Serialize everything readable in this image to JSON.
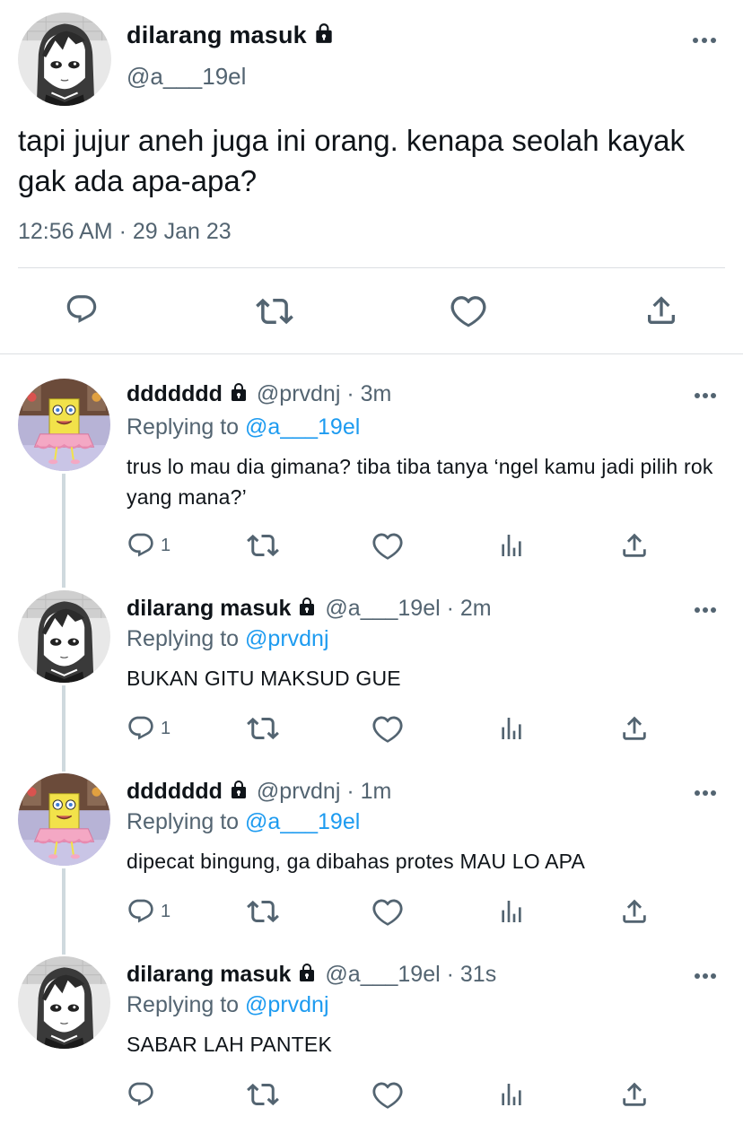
{
  "main_tweet": {
    "display_name": "dilarang masuk",
    "handle": "@a___19el",
    "text": "tapi jujur aneh juga ini orang. kenapa seolah kayak gak ada apa-apa?",
    "timestamp": "12:56 AM · 29 Jan 23"
  },
  "replies": [
    {
      "display_name": "ddddddd",
      "handle_time": "@prvdnj · 3m",
      "replying_prefix": "Replying to",
      "replying_to": "@a___19el",
      "text": "trus lo mau dia gimana? tiba tiba tanya ‘ngel kamu jadi pilih rok yang mana?’",
      "reply_count": "1"
    },
    {
      "display_name": "dilarang masuk",
      "handle_time": "@a___19el · 2m",
      "replying_prefix": "Replying to",
      "replying_to": "@prvdnj",
      "text": "BUKAN GITU MAKSUD GUE",
      "reply_count": "1"
    },
    {
      "display_name": "ddddddd",
      "handle_time": "@prvdnj · 1m",
      "replying_prefix": "Replying to",
      "replying_to": "@a___19el",
      "text": "dipecat bingung, ga dibahas protes MAU LO APA",
      "reply_count": "1"
    },
    {
      "display_name": "dilarang masuk",
      "handle_time": "@a___19el · 31s",
      "replying_prefix": "Replying to",
      "replying_to": "@prvdnj",
      "text": "SABAR LAH PANTEK",
      "reply_count": ""
    }
  ],
  "colors": {
    "text": "#0f1419",
    "secondary": "#536471",
    "link": "#1d9bf0",
    "divider": "#dcdfe2"
  },
  "icons": [
    "lock-icon",
    "more-icon",
    "reply-icon",
    "retweet-icon",
    "like-icon",
    "views-icon",
    "share-icon"
  ]
}
